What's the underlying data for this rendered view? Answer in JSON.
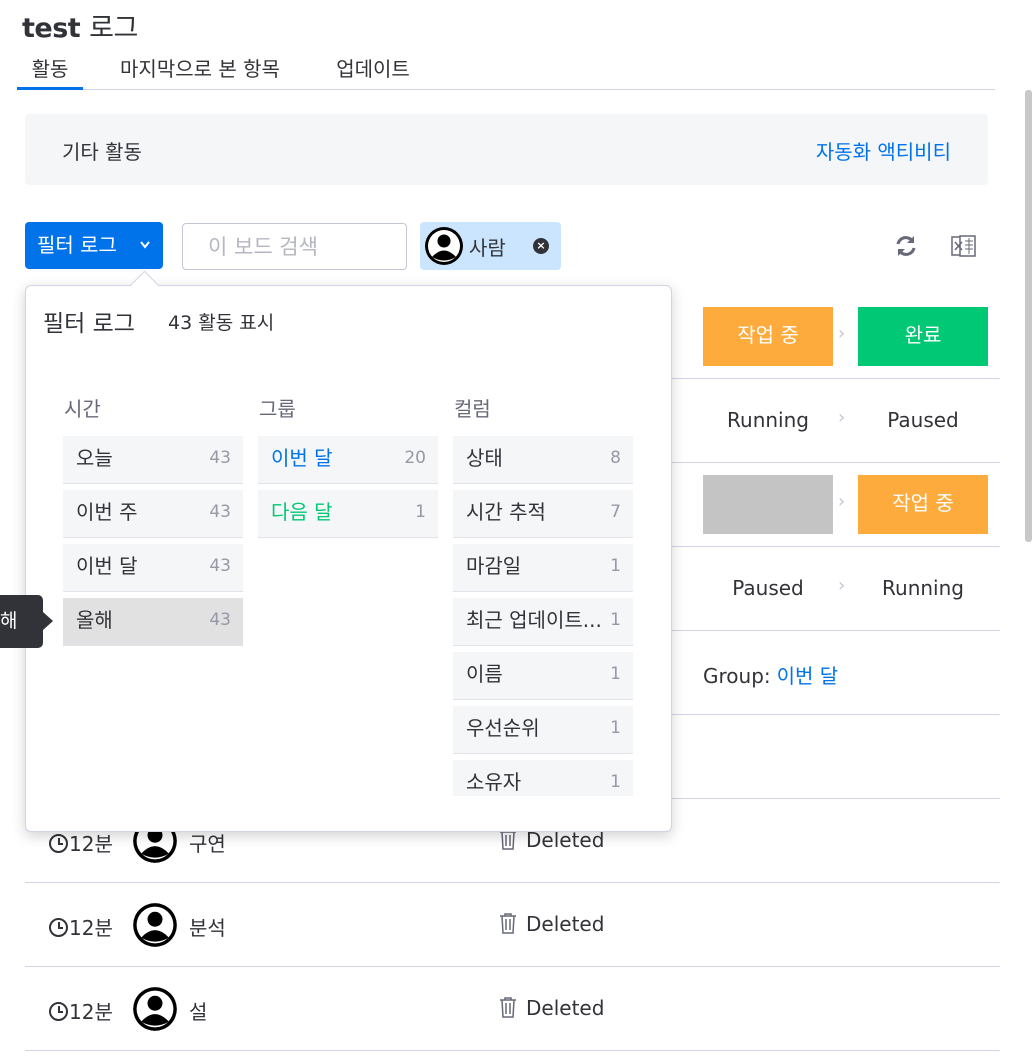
{
  "header": {
    "board": "test",
    "title_suffix": "로그"
  },
  "tabs": [
    {
      "label": "활동",
      "active": true
    },
    {
      "label": "마지막으로 본 항목",
      "active": false
    },
    {
      "label": "업데이트",
      "active": false
    }
  ],
  "banner": {
    "left": "기타 활동",
    "right": "자동화 액티비티"
  },
  "toolbar": {
    "filter_label": "필터 로그",
    "search_placeholder": "이 보드 검색",
    "person_chip": "사람",
    "refresh_icon": "refresh-icon",
    "excel_icon": "excel-export-icon"
  },
  "panel": {
    "title": "필터 로그",
    "count_text": "43 활동 표시",
    "columns": {
      "time": {
        "header": "시간",
        "items": [
          {
            "label": "오늘",
            "count": "43"
          },
          {
            "label": "이번 주",
            "count": "43"
          },
          {
            "label": "이번 달",
            "count": "43"
          },
          {
            "label": "올해",
            "count": "43"
          }
        ]
      },
      "group": {
        "header": "그룹",
        "items": [
          {
            "label": "이번 달",
            "count": "20"
          },
          {
            "label": "다음 달",
            "count": "1"
          }
        ]
      },
      "column": {
        "header": "컬럼",
        "items": [
          {
            "label": "상태",
            "count": "8"
          },
          {
            "label": "시간 추적",
            "count": "7"
          },
          {
            "label": "마감일",
            "count": "1"
          },
          {
            "label": "최근 업데이트...",
            "count": "1"
          },
          {
            "label": "이름",
            "count": "1"
          },
          {
            "label": "우선순위",
            "count": "1"
          },
          {
            "label": "소유자",
            "count": "1"
          }
        ]
      }
    }
  },
  "tooltip": {
    "text": "해"
  },
  "log_rows": [
    {
      "from": "작업 중",
      "to": "완료",
      "from_color": "#fdab3d",
      "to_color": "#00c875"
    },
    {
      "from": "Running",
      "to": "Paused"
    },
    {
      "from": "",
      "to": "작업 중",
      "from_color": "#c4c4c4",
      "to_color": "#fdab3d"
    },
    {
      "from": "Paused",
      "to": "Running"
    },
    {
      "group_prefix": "Group:",
      "group_value": "이번 달"
    }
  ],
  "log_entries": [
    {
      "time": "12분",
      "name": "구연",
      "action": "Deleted"
    },
    {
      "time": "12분",
      "name": "분석",
      "action": "Deleted"
    },
    {
      "time": "12분",
      "name": "설",
      "action": "Deleted"
    }
  ]
}
